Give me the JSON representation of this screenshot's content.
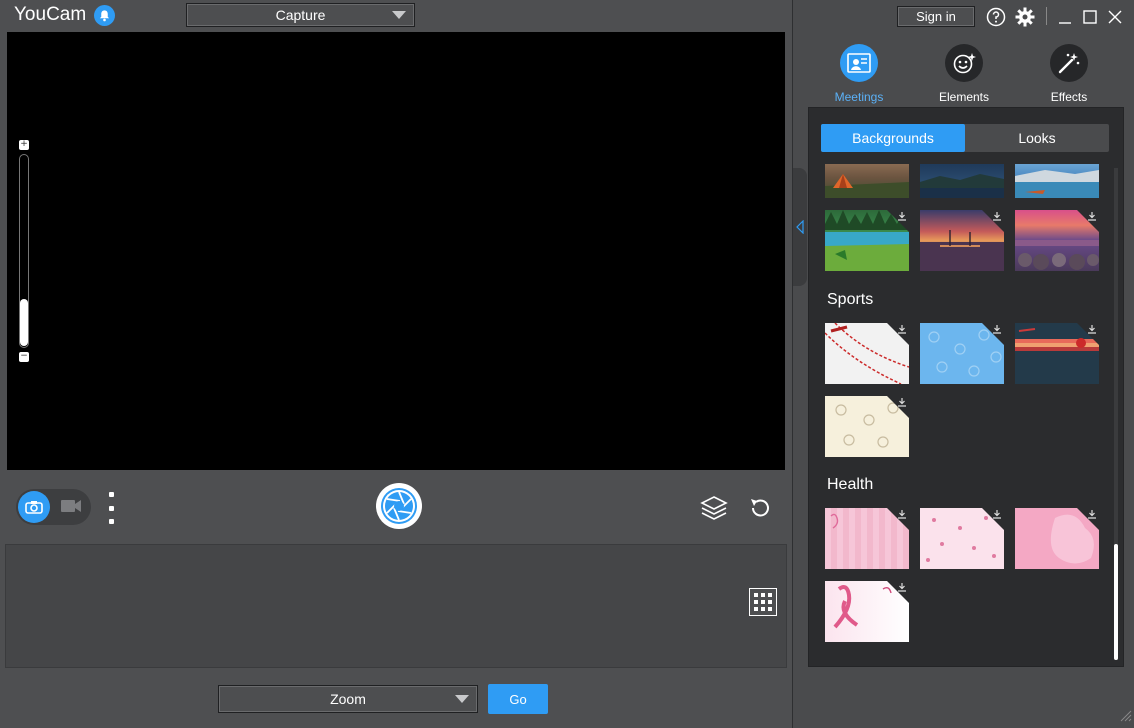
{
  "app": {
    "title": "YouCam"
  },
  "header": {
    "capture_dropdown": "Capture"
  },
  "bottom": {
    "meeting_dropdown": "Zoom",
    "go_label": "Go"
  },
  "top_right": {
    "signin_label": "Sign in"
  },
  "tabs": [
    {
      "label": "Meetings",
      "icon": "meetings-icon",
      "active": true
    },
    {
      "label": "Elements",
      "icon": "elements-icon",
      "active": false
    },
    {
      "label": "Effects",
      "icon": "effects-icon",
      "active": false
    }
  ],
  "segment": {
    "backgrounds": "Backgrounds",
    "looks": "Looks"
  },
  "sections": {
    "sports": "Sports",
    "health": "Health"
  },
  "colors": {
    "accent": "#2f9cf4",
    "panel_bg": "#2b2c2e",
    "app_bg": "#4e4f51"
  },
  "zoom_level_fraction": 0.2
}
